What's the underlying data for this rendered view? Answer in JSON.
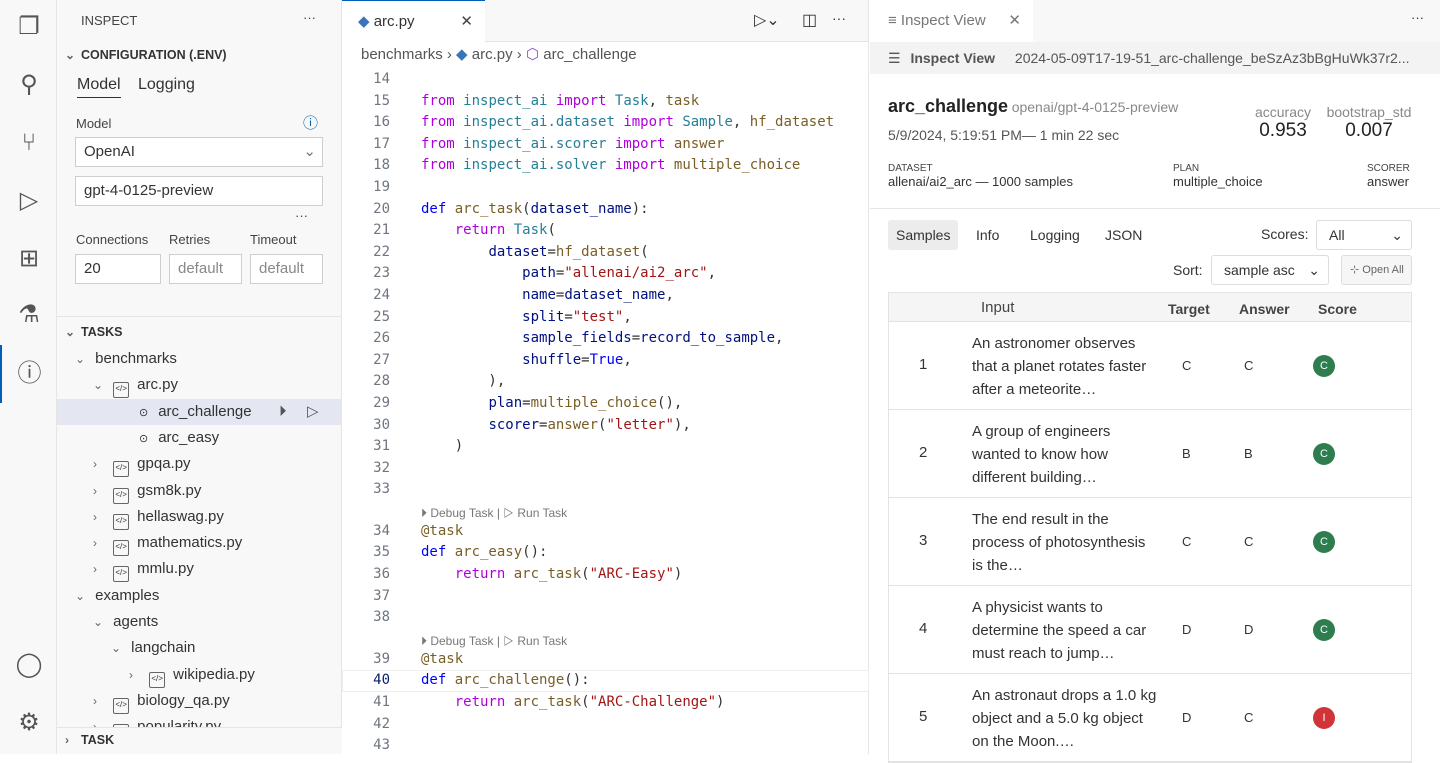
{
  "activity_bar": [
    "explorer-icon",
    "search-icon",
    "source-control-icon",
    "run-debug-icon",
    "extensions-icon",
    "testing-icon",
    "inspect-icon",
    "account-icon",
    "settings-icon"
  ],
  "sidebar": {
    "title": "INSPECT",
    "config_header": "CONFIGURATION (.ENV)",
    "tabs": [
      "Model",
      "Logging"
    ],
    "model_label": "Model",
    "provider": "OpenAI",
    "model_name": "gpt-4-0125-preview",
    "connections_label": "Connections",
    "retries_label": "Retries",
    "timeout_label": "Timeout",
    "connections": "20",
    "retries_placeholder": "default",
    "timeout_placeholder": "default",
    "tasks_header": "TASKS",
    "tree": [
      {
        "label": "benchmarks",
        "indent": 1,
        "chev": "down",
        "type": "folder"
      },
      {
        "label": "arc.py",
        "indent": 2,
        "chev": "down",
        "type": "file"
      },
      {
        "label": "arc_challenge",
        "indent": 3,
        "type": "task",
        "selected": true
      },
      {
        "label": "arc_easy",
        "indent": 3,
        "type": "task"
      },
      {
        "label": "gpqa.py",
        "indent": 2,
        "chev": "right",
        "type": "file"
      },
      {
        "label": "gsm8k.py",
        "indent": 2,
        "chev": "right",
        "type": "file"
      },
      {
        "label": "hellaswag.py",
        "indent": 2,
        "chev": "right",
        "type": "file"
      },
      {
        "label": "mathematics.py",
        "indent": 2,
        "chev": "right",
        "type": "file"
      },
      {
        "label": "mmlu.py",
        "indent": 2,
        "chev": "right",
        "type": "file"
      },
      {
        "label": "examples",
        "indent": 1,
        "chev": "down",
        "type": "folder"
      },
      {
        "label": "agents",
        "indent": 2,
        "chev": "down",
        "type": "folder"
      },
      {
        "label": "langchain",
        "indent": 3,
        "chev": "down",
        "type": "folder"
      },
      {
        "label": "wikipedia.py",
        "indent": 4,
        "chev": "right",
        "type": "file"
      },
      {
        "label": "biology_qa.py",
        "indent": 2,
        "chev": "right",
        "type": "file"
      },
      {
        "label": "popularity.py",
        "indent": 2,
        "chev": "right",
        "type": "file"
      }
    ],
    "task_header": "TASK"
  },
  "editor": {
    "tab": "arc.py",
    "breadcrumb": [
      "benchmarks",
      "arc.py",
      "arc_challenge"
    ],
    "codelens": {
      "debug": "Debug Task",
      "sep": "|",
      "run": "Run Task"
    },
    "lines": [
      {
        "n": "14",
        "t": []
      },
      {
        "n": "15",
        "t": [
          [
            "kw",
            "from "
          ],
          [
            "md",
            "inspect_ai "
          ],
          [
            "kw",
            "import "
          ],
          [
            "md",
            "Task"
          ],
          [
            "",
            ","
          ],
          [
            "fn",
            " task"
          ]
        ]
      },
      {
        "n": "16",
        "t": [
          [
            "kw",
            "from "
          ],
          [
            "md",
            "inspect_ai.dataset "
          ],
          [
            "kw",
            "import "
          ],
          [
            "md",
            "Sample"
          ],
          [
            "",
            ", "
          ],
          [
            "fn",
            "hf_dataset"
          ]
        ]
      },
      {
        "n": "17",
        "t": [
          [
            "kw",
            "from "
          ],
          [
            "md",
            "inspect_ai.scorer "
          ],
          [
            "kw",
            "import "
          ],
          [
            "fn",
            "answer"
          ]
        ]
      },
      {
        "n": "18",
        "t": [
          [
            "kw",
            "from "
          ],
          [
            "md",
            "inspect_ai.solver "
          ],
          [
            "kw",
            "import "
          ],
          [
            "fn",
            "multiple_choice"
          ]
        ]
      },
      {
        "n": "19",
        "t": []
      },
      {
        "n": "20",
        "t": [
          [
            "df",
            "def "
          ],
          [
            "fn",
            "arc_task"
          ],
          [
            "",
            "("
          ],
          [
            "pr",
            "dataset_name"
          ],
          [
            "",
            "):"
          ]
        ]
      },
      {
        "n": "21",
        "t": [
          [
            "",
            "    "
          ],
          [
            "kw",
            "return "
          ],
          [
            "md",
            "Task"
          ],
          [
            "",
            "("
          ]
        ]
      },
      {
        "n": "22",
        "t": [
          [
            "",
            "        "
          ],
          [
            "pr",
            "dataset"
          ],
          [
            "",
            "="
          ],
          [
            "fn",
            "hf_dataset"
          ],
          [
            "",
            "("
          ]
        ]
      },
      {
        "n": "23",
        "t": [
          [
            "",
            "            "
          ],
          [
            "pr",
            "path"
          ],
          [
            "",
            "="
          ],
          [
            "st",
            "\"allenai/ai2_arc\""
          ],
          [
            "",
            ","
          ]
        ]
      },
      {
        "n": "24",
        "t": [
          [
            "",
            "            "
          ],
          [
            "pr",
            "name"
          ],
          [
            "",
            "="
          ],
          [
            "pr",
            "dataset_name"
          ],
          [
            "",
            ","
          ]
        ]
      },
      {
        "n": "25",
        "t": [
          [
            "",
            "            "
          ],
          [
            "pr",
            "split"
          ],
          [
            "",
            "="
          ],
          [
            "st",
            "\"test\""
          ],
          [
            "",
            ","
          ]
        ]
      },
      {
        "n": "26",
        "t": [
          [
            "",
            "            "
          ],
          [
            "pr",
            "sample_fields"
          ],
          [
            "",
            "="
          ],
          [
            "pr",
            "record_to_sample"
          ],
          [
            "",
            ","
          ]
        ]
      },
      {
        "n": "27",
        "t": [
          [
            "",
            "            "
          ],
          [
            "pr",
            "shuffle"
          ],
          [
            "",
            "="
          ],
          [
            "df",
            "True"
          ],
          [
            "",
            ","
          ]
        ]
      },
      {
        "n": "28",
        "t": [
          [
            "",
            "        ),"
          ]
        ]
      },
      {
        "n": "29",
        "t": [
          [
            "",
            "        "
          ],
          [
            "pr",
            "plan"
          ],
          [
            "",
            "="
          ],
          [
            "fn",
            "multiple_choice"
          ],
          [
            "",
            "(),"
          ]
        ]
      },
      {
        "n": "30",
        "t": [
          [
            "",
            "        "
          ],
          [
            "pr",
            "scorer"
          ],
          [
            "",
            "="
          ],
          [
            "fn",
            "answer"
          ],
          [
            "",
            "("
          ],
          [
            "st",
            "\"letter\""
          ],
          [
            "",
            "),"
          ]
        ]
      },
      {
        "n": "31",
        "t": [
          [
            "",
            "    )"
          ]
        ]
      },
      {
        "n": "32",
        "t": []
      },
      {
        "n": "33",
        "t": []
      },
      {
        "lens": true
      },
      {
        "n": "34",
        "t": [
          [
            "dc",
            "@task"
          ]
        ]
      },
      {
        "n": "35",
        "t": [
          [
            "df",
            "def "
          ],
          [
            "fn",
            "arc_easy"
          ],
          [
            "",
            "():"
          ]
        ]
      },
      {
        "n": "36",
        "t": [
          [
            "",
            "    "
          ],
          [
            "kw",
            "return "
          ],
          [
            "fn",
            "arc_task"
          ],
          [
            "",
            "("
          ],
          [
            "st",
            "\"ARC-Easy\""
          ],
          [
            "",
            ")"
          ]
        ]
      },
      {
        "n": "37",
        "t": []
      },
      {
        "n": "38",
        "t": []
      },
      {
        "lens": true
      },
      {
        "n": "39",
        "t": [
          [
            "dc",
            "@task"
          ]
        ]
      },
      {
        "n": "40",
        "t": [
          [
            "df",
            "def "
          ],
          [
            "fn",
            "arc_challenge"
          ],
          [
            "",
            "():"
          ]
        ],
        "cur": true
      },
      {
        "n": "41",
        "t": [
          [
            "",
            "    "
          ],
          [
            "kw",
            "return "
          ],
          [
            "fn",
            "arc_task"
          ],
          [
            "",
            "("
          ],
          [
            "st",
            "\"ARC-Challenge\""
          ],
          [
            "",
            ")"
          ]
        ]
      },
      {
        "n": "42",
        "t": []
      },
      {
        "n": "43",
        "t": []
      }
    ]
  },
  "inspect_view": {
    "tab": "Inspect View",
    "header_title": "Inspect View",
    "log_file": "2024-05-09T17-19-51_arc-challenge_beSzAz3bBgHuWk37r2...",
    "task": "arc_challenge",
    "model": "openai/gpt-4-0125-preview",
    "datetime": "5/9/2024, 5:19:51 PM— 1 min 22 sec",
    "metrics": [
      {
        "name": "accuracy",
        "value": "0.953"
      },
      {
        "name": "bootstrap_std",
        "value": "0.007"
      }
    ],
    "dataset_label": "DATASET",
    "dataset": "allenai/ai2_arc — 1000 samples",
    "plan_label": "PLAN",
    "plan": "multiple_choice",
    "scorer_label": "SCORER",
    "scorer": "answer",
    "tabs": [
      "Samples",
      "Info",
      "Logging",
      "JSON"
    ],
    "scores_label": "Scores:",
    "scores_value": "All",
    "sort_label": "Sort:",
    "sort_value": "sample asc",
    "open_all": "Open All",
    "columns": [
      "Input",
      "Target",
      "Answer",
      "Score"
    ],
    "rows": [
      {
        "id": "1",
        "input": "An astronomer observes that a planet rotates faster after a meteorite…",
        "target": "C",
        "answer": "C",
        "score": "C"
      },
      {
        "id": "2",
        "input": "A group of engineers wanted to know how different building…",
        "target": "B",
        "answer": "B",
        "score": "C"
      },
      {
        "id": "3",
        "input": "The end result in the process of photosynthesis is the…",
        "target": "C",
        "answer": "C",
        "score": "C"
      },
      {
        "id": "4",
        "input": "A physicist wants to determine the speed a car must reach to jump…",
        "target": "D",
        "answer": "D",
        "score": "C"
      },
      {
        "id": "5",
        "input": "An astronaut drops a 1.0 kg object and a 5.0 kg object on the Moon.…",
        "target": "D",
        "answer": "C",
        "score": "I"
      }
    ],
    "colors": {
      "correct": "#2e7d4f",
      "incorrect": "#d13438",
      "accent": "#005fb8"
    }
  }
}
